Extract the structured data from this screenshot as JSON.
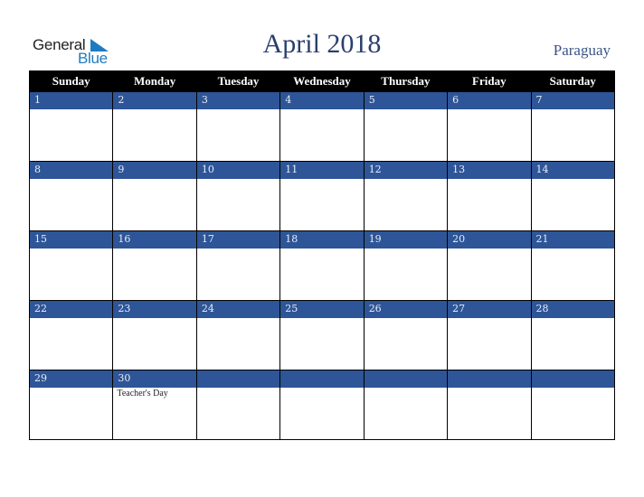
{
  "logo": {
    "line1": "General",
    "line2": "Blue"
  },
  "header": {
    "title": "April 2018",
    "country": "Paraguay"
  },
  "colors": {
    "header_bg": "#000000",
    "day_bar": "#2e5597",
    "title": "#2a3f6e",
    "logo_blue": "#1f7bc1"
  },
  "weekdays": [
    "Sunday",
    "Monday",
    "Tuesday",
    "Wednesday",
    "Thursday",
    "Friday",
    "Saturday"
  ],
  "weeks": [
    [
      {
        "day": "1",
        "event": ""
      },
      {
        "day": "2",
        "event": ""
      },
      {
        "day": "3",
        "event": ""
      },
      {
        "day": "4",
        "event": ""
      },
      {
        "day": "5",
        "event": ""
      },
      {
        "day": "6",
        "event": ""
      },
      {
        "day": "7",
        "event": ""
      }
    ],
    [
      {
        "day": "8",
        "event": ""
      },
      {
        "day": "9",
        "event": ""
      },
      {
        "day": "10",
        "event": ""
      },
      {
        "day": "11",
        "event": ""
      },
      {
        "day": "12",
        "event": ""
      },
      {
        "day": "13",
        "event": ""
      },
      {
        "day": "14",
        "event": ""
      }
    ],
    [
      {
        "day": "15",
        "event": ""
      },
      {
        "day": "16",
        "event": ""
      },
      {
        "day": "17",
        "event": ""
      },
      {
        "day": "18",
        "event": ""
      },
      {
        "day": "19",
        "event": ""
      },
      {
        "day": "20",
        "event": ""
      },
      {
        "day": "21",
        "event": ""
      }
    ],
    [
      {
        "day": "22",
        "event": ""
      },
      {
        "day": "23",
        "event": ""
      },
      {
        "day": "24",
        "event": ""
      },
      {
        "day": "25",
        "event": ""
      },
      {
        "day": "26",
        "event": ""
      },
      {
        "day": "27",
        "event": ""
      },
      {
        "day": "28",
        "event": ""
      }
    ],
    [
      {
        "day": "29",
        "event": ""
      },
      {
        "day": "30",
        "event": "Teacher's Day"
      },
      {
        "day": "",
        "event": ""
      },
      {
        "day": "",
        "event": ""
      },
      {
        "day": "",
        "event": ""
      },
      {
        "day": "",
        "event": ""
      },
      {
        "day": "",
        "event": ""
      }
    ]
  ]
}
